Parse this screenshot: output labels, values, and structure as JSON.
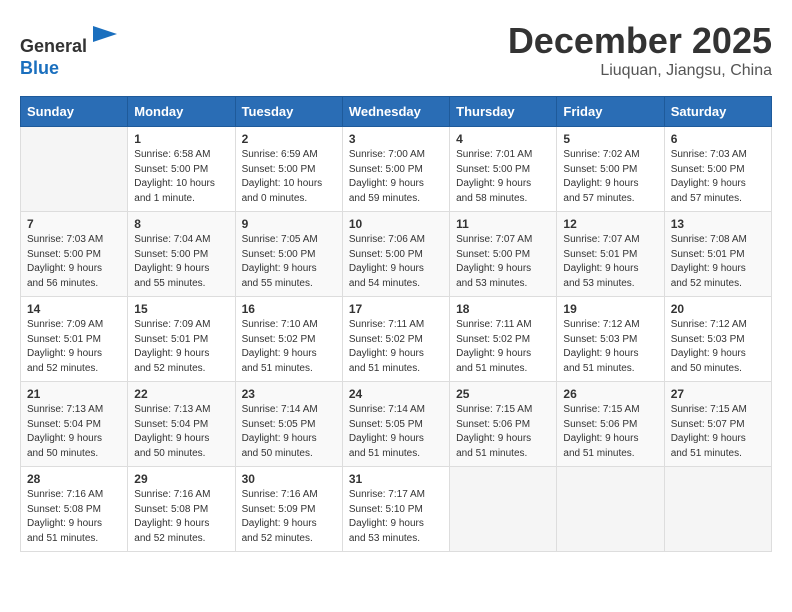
{
  "header": {
    "logo_line1": "General",
    "logo_line2": "Blue",
    "month": "December 2025",
    "location": "Liuquan, Jiangsu, China"
  },
  "weekdays": [
    "Sunday",
    "Monday",
    "Tuesday",
    "Wednesday",
    "Thursday",
    "Friday",
    "Saturday"
  ],
  "weeks": [
    [
      {
        "day": "",
        "info": ""
      },
      {
        "day": "1",
        "info": "Sunrise: 6:58 AM\nSunset: 5:00 PM\nDaylight: 10 hours\nand 1 minute."
      },
      {
        "day": "2",
        "info": "Sunrise: 6:59 AM\nSunset: 5:00 PM\nDaylight: 10 hours\nand 0 minutes."
      },
      {
        "day": "3",
        "info": "Sunrise: 7:00 AM\nSunset: 5:00 PM\nDaylight: 9 hours\nand 59 minutes."
      },
      {
        "day": "4",
        "info": "Sunrise: 7:01 AM\nSunset: 5:00 PM\nDaylight: 9 hours\nand 58 minutes."
      },
      {
        "day": "5",
        "info": "Sunrise: 7:02 AM\nSunset: 5:00 PM\nDaylight: 9 hours\nand 57 minutes."
      },
      {
        "day": "6",
        "info": "Sunrise: 7:03 AM\nSunset: 5:00 PM\nDaylight: 9 hours\nand 57 minutes."
      }
    ],
    [
      {
        "day": "7",
        "info": "Sunrise: 7:03 AM\nSunset: 5:00 PM\nDaylight: 9 hours\nand 56 minutes."
      },
      {
        "day": "8",
        "info": "Sunrise: 7:04 AM\nSunset: 5:00 PM\nDaylight: 9 hours\nand 55 minutes."
      },
      {
        "day": "9",
        "info": "Sunrise: 7:05 AM\nSunset: 5:00 PM\nDaylight: 9 hours\nand 55 minutes."
      },
      {
        "day": "10",
        "info": "Sunrise: 7:06 AM\nSunset: 5:00 PM\nDaylight: 9 hours\nand 54 minutes."
      },
      {
        "day": "11",
        "info": "Sunrise: 7:07 AM\nSunset: 5:00 PM\nDaylight: 9 hours\nand 53 minutes."
      },
      {
        "day": "12",
        "info": "Sunrise: 7:07 AM\nSunset: 5:01 PM\nDaylight: 9 hours\nand 53 minutes."
      },
      {
        "day": "13",
        "info": "Sunrise: 7:08 AM\nSunset: 5:01 PM\nDaylight: 9 hours\nand 52 minutes."
      }
    ],
    [
      {
        "day": "14",
        "info": "Sunrise: 7:09 AM\nSunset: 5:01 PM\nDaylight: 9 hours\nand 52 minutes."
      },
      {
        "day": "15",
        "info": "Sunrise: 7:09 AM\nSunset: 5:01 PM\nDaylight: 9 hours\nand 52 minutes."
      },
      {
        "day": "16",
        "info": "Sunrise: 7:10 AM\nSunset: 5:02 PM\nDaylight: 9 hours\nand 51 minutes."
      },
      {
        "day": "17",
        "info": "Sunrise: 7:11 AM\nSunset: 5:02 PM\nDaylight: 9 hours\nand 51 minutes."
      },
      {
        "day": "18",
        "info": "Sunrise: 7:11 AM\nSunset: 5:02 PM\nDaylight: 9 hours\nand 51 minutes."
      },
      {
        "day": "19",
        "info": "Sunrise: 7:12 AM\nSunset: 5:03 PM\nDaylight: 9 hours\nand 51 minutes."
      },
      {
        "day": "20",
        "info": "Sunrise: 7:12 AM\nSunset: 5:03 PM\nDaylight: 9 hours\nand 50 minutes."
      }
    ],
    [
      {
        "day": "21",
        "info": "Sunrise: 7:13 AM\nSunset: 5:04 PM\nDaylight: 9 hours\nand 50 minutes."
      },
      {
        "day": "22",
        "info": "Sunrise: 7:13 AM\nSunset: 5:04 PM\nDaylight: 9 hours\nand 50 minutes."
      },
      {
        "day": "23",
        "info": "Sunrise: 7:14 AM\nSunset: 5:05 PM\nDaylight: 9 hours\nand 50 minutes."
      },
      {
        "day": "24",
        "info": "Sunrise: 7:14 AM\nSunset: 5:05 PM\nDaylight: 9 hours\nand 51 minutes."
      },
      {
        "day": "25",
        "info": "Sunrise: 7:15 AM\nSunset: 5:06 PM\nDaylight: 9 hours\nand 51 minutes."
      },
      {
        "day": "26",
        "info": "Sunrise: 7:15 AM\nSunset: 5:06 PM\nDaylight: 9 hours\nand 51 minutes."
      },
      {
        "day": "27",
        "info": "Sunrise: 7:15 AM\nSunset: 5:07 PM\nDaylight: 9 hours\nand 51 minutes."
      }
    ],
    [
      {
        "day": "28",
        "info": "Sunrise: 7:16 AM\nSunset: 5:08 PM\nDaylight: 9 hours\nand 51 minutes."
      },
      {
        "day": "29",
        "info": "Sunrise: 7:16 AM\nSunset: 5:08 PM\nDaylight: 9 hours\nand 52 minutes."
      },
      {
        "day": "30",
        "info": "Sunrise: 7:16 AM\nSunset: 5:09 PM\nDaylight: 9 hours\nand 52 minutes."
      },
      {
        "day": "31",
        "info": "Sunrise: 7:17 AM\nSunset: 5:10 PM\nDaylight: 9 hours\nand 53 minutes."
      },
      {
        "day": "",
        "info": ""
      },
      {
        "day": "",
        "info": ""
      },
      {
        "day": "",
        "info": ""
      }
    ]
  ]
}
